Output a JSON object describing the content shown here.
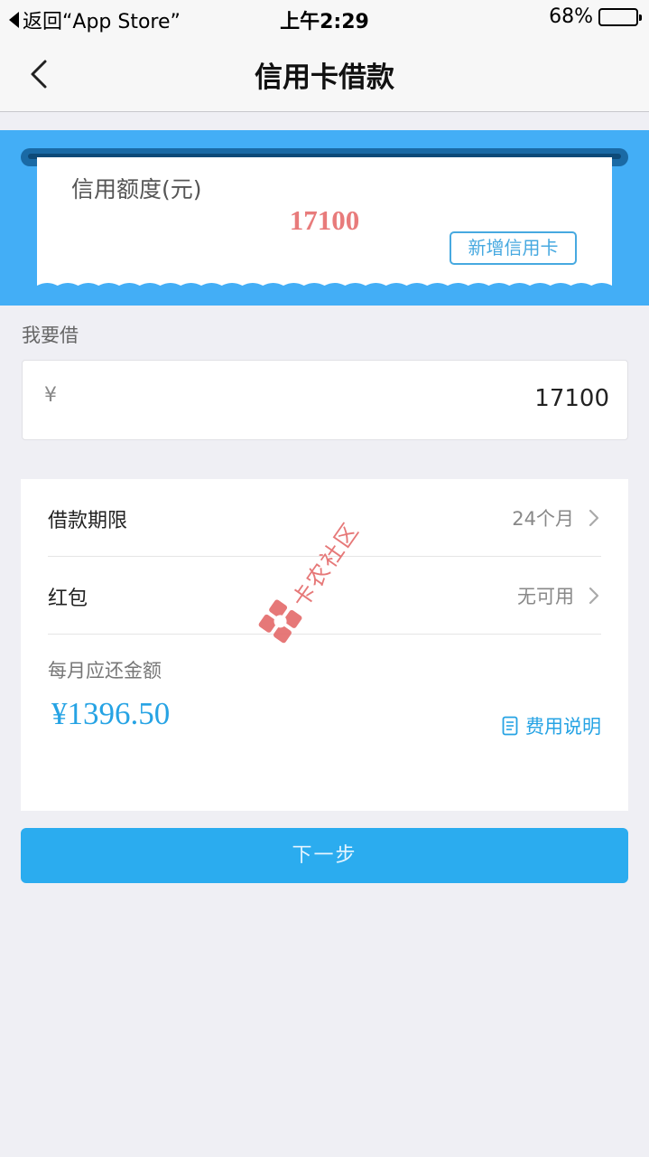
{
  "status_bar": {
    "back_app": "返回“App Store”",
    "time": "上午2:29",
    "battery_percent": "68%",
    "battery_level": 0.68
  },
  "nav": {
    "title": "信用卡借款"
  },
  "credit_card": {
    "label": "信用额度(元)",
    "amount": "17100",
    "add_card_label": "新增信用卡"
  },
  "borrow": {
    "label": "我要借",
    "currency_symbol": "¥",
    "value": "17100"
  },
  "details": {
    "term_label": "借款期限",
    "term_value": "24个月",
    "redpacket_label": "红包",
    "redpacket_value": "无可用",
    "monthly_label": "每月应还金额",
    "monthly_value": "¥1396.50",
    "fee_link_label": "费用说明"
  },
  "actions": {
    "next_label": "下一步"
  },
  "watermark": {
    "text": "卡农社区"
  },
  "colors": {
    "banner_blue": "#43aef6",
    "accent_blue": "#26a3e4",
    "amount_red": "#e87b7b",
    "button_blue": "#2bacef"
  }
}
